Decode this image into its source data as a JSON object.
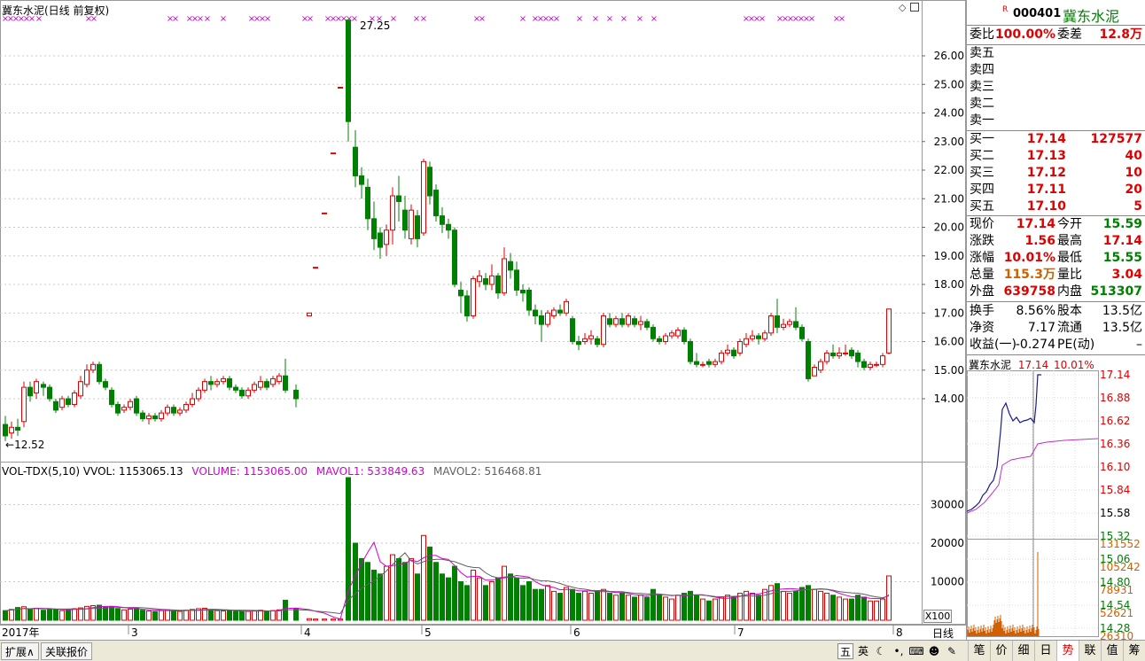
{
  "stock": {
    "code": "000401",
    "name": "冀东水泥",
    "flag": "R"
  },
  "chart_title": "冀东水泥(日线 前复权)",
  "price_axis": {
    "ticks": [
      "26.00",
      "25.00",
      "24.00",
      "23.00",
      "22.00",
      "21.00",
      "20.00",
      "19.00",
      "18.00",
      "17.00",
      "16.00",
      "15.00",
      "14.00"
    ]
  },
  "annotations": {
    "high": "27.25",
    "low": "12.52"
  },
  "vol_header": {
    "name": "VOL-TDX(5,10)",
    "vvol": "VVOL: 1153065.13",
    "volume": "VOLUME: 1153065.00",
    "mavol1": "MAVOL1: 533849.63",
    "mavol2": "MAVOL2: 516468.81"
  },
  "vol_axis": {
    "ticks": [
      "30000",
      "20000",
      "10000"
    ],
    "unit_label": "X100"
  },
  "date_axis": {
    "labels": [
      "2017年",
      "3",
      "4",
      "5",
      "6",
      "7",
      "8"
    ],
    "period": "日线"
  },
  "colors": {
    "up": "#e00000",
    "down": "#008000",
    "ma1": "#d000d0",
    "ma2": "#606060"
  },
  "quote": {
    "weibi_label": "委比",
    "weibi": "100.00%",
    "weicha_label": "委差",
    "weicha": "12.8万",
    "sell": [
      {
        "label": "卖五"
      },
      {
        "label": "卖四"
      },
      {
        "label": "卖三"
      },
      {
        "label": "卖二"
      },
      {
        "label": "卖一"
      }
    ],
    "buy": [
      {
        "label": "买一",
        "price": "17.14",
        "vol": "127577"
      },
      {
        "label": "买二",
        "price": "17.13",
        "vol": "40"
      },
      {
        "label": "买三",
        "price": "17.12",
        "vol": "10"
      },
      {
        "label": "买四",
        "price": "17.11",
        "vol": "20"
      },
      {
        "label": "买五",
        "price": "17.10",
        "vol": "5"
      }
    ],
    "stats": [
      {
        "l1": "现价",
        "v1": "17.14",
        "c1": "red",
        "l2": "今开",
        "v2": "15.59",
        "c2": "green"
      },
      {
        "l1": "涨跌",
        "v1": "1.56",
        "c1": "red",
        "l2": "最高",
        "v2": "17.14",
        "c2": "red"
      },
      {
        "l1": "涨幅",
        "v1": "10.01%",
        "c1": "red",
        "l2": "最低",
        "v2": "15.55",
        "c2": "green"
      },
      {
        "l1": "总量",
        "v1": "115.3万",
        "c1": "orange",
        "l2": "量比",
        "v2": "3.04",
        "c2": "red"
      },
      {
        "l1": "外盘",
        "v1": "639758",
        "c1": "red",
        "l2": "内盘",
        "v2": "513307",
        "c2": "green"
      }
    ],
    "fund": [
      {
        "l1": "换手",
        "v1": "8.56%",
        "l2": "股本",
        "v2": "13.5亿"
      },
      {
        "l1": "净资",
        "v1": "7.17",
        "l2": "流通",
        "v2": "13.5亿"
      },
      {
        "l1": "收益(一)",
        "v1": "-0.274",
        "l2": "PE(动)",
        "v2": "–"
      }
    ]
  },
  "mini": {
    "name": "冀东水泥",
    "price": "17.14",
    "pct": "10.01%",
    "price_ticks": [
      "17.14",
      "16.88",
      "16.62",
      "16.36",
      "16.10",
      "15.84",
      "15.58",
      "15.32",
      "15.06",
      "14.80",
      "14.54",
      "14.28"
    ],
    "vol_ticks": [
      "131552",
      "105242",
      "78931",
      "52621",
      "26310"
    ]
  },
  "bottom": {
    "left_tabs": [
      "扩展∧",
      "关联报价"
    ],
    "right_tabs": [
      "笔",
      "价",
      "细",
      "日",
      "势",
      "联",
      "值",
      "筹"
    ],
    "ime": [
      "五",
      "英"
    ]
  }
}
